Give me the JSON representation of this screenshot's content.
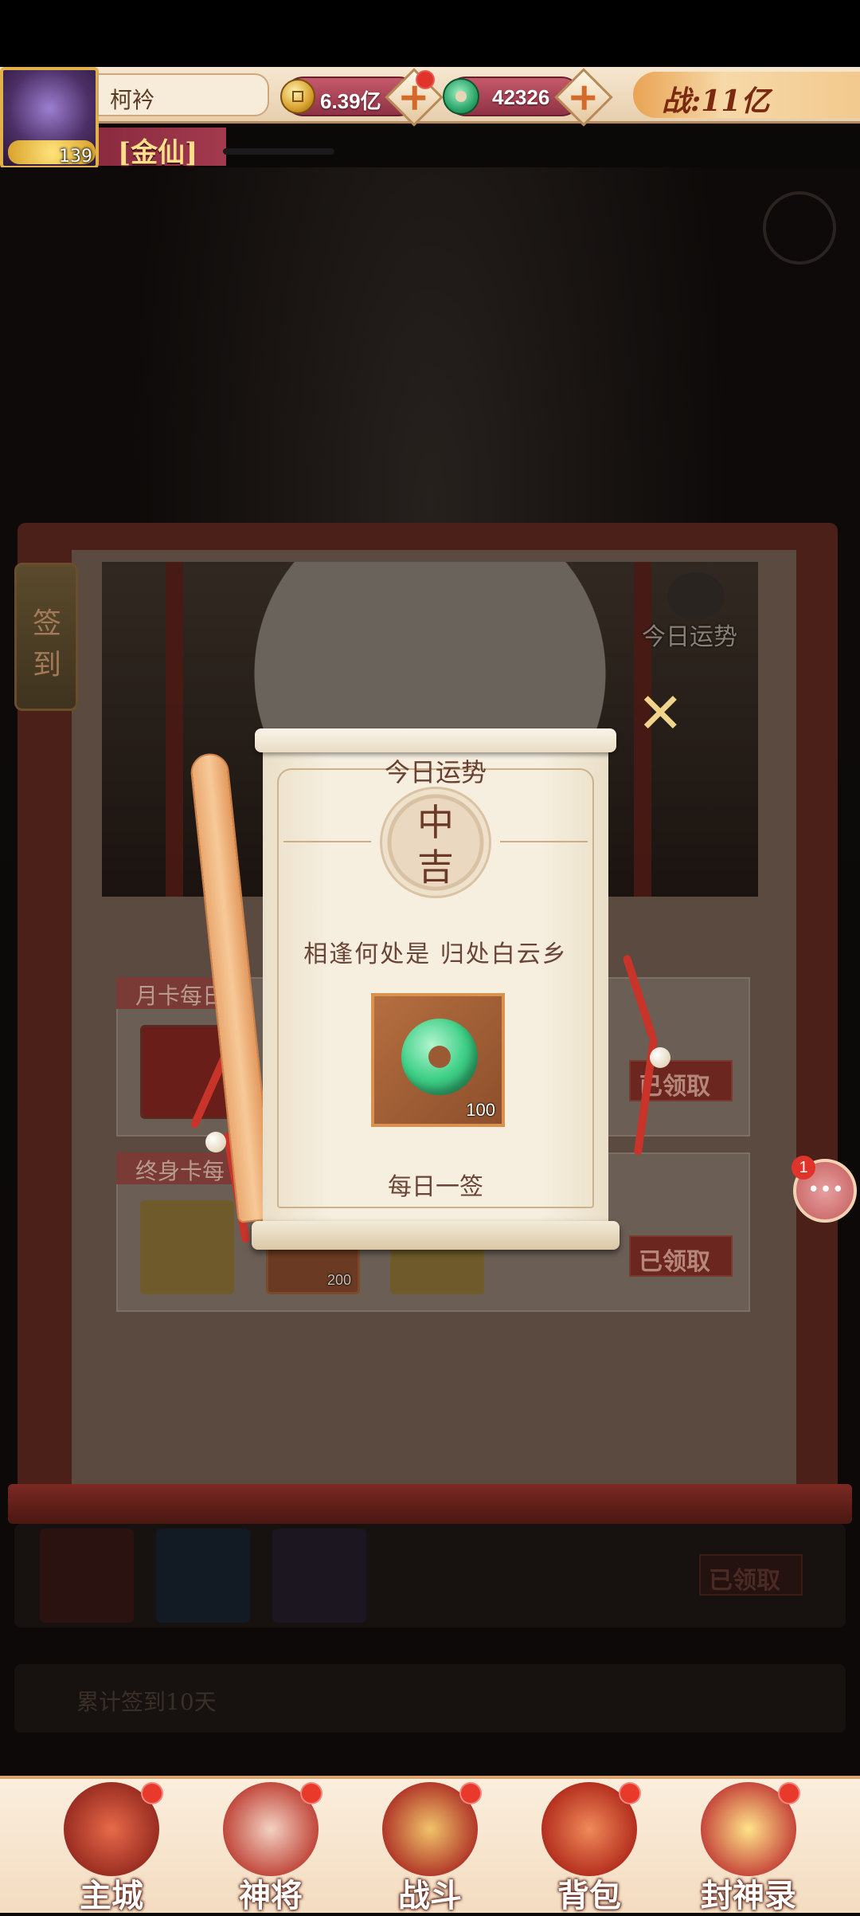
{
  "hud": {
    "player_name": "柯衿",
    "level": "139",
    "title": "[金仙]",
    "gold": "6.39亿",
    "jade": "42326",
    "power": "战:11亿"
  },
  "signin": {
    "tab_label_top": "签",
    "tab_label_bottom": "到",
    "today_fortune_label": "今日运势",
    "row1_tag": "月卡每日",
    "row2_tag": "终身卡每",
    "claimed": "已领取",
    "row2_item_count": "200",
    "bg_claimed": "已领取",
    "bg_streak": "累计签到10天"
  },
  "popup": {
    "title": "今日运势",
    "fortune_top": "中",
    "fortune_bottom": "吉",
    "poem": "相逢何处是  归处白云乡",
    "item_count": "100",
    "daily_label": "每日一签"
  },
  "chat": {
    "badge": "1"
  },
  "nav": {
    "items": [
      {
        "label": "主城",
        "icon": "castle-icon"
      },
      {
        "label": "神将",
        "icon": "hero-icon"
      },
      {
        "label": "战斗",
        "icon": "crossed-swords-icon"
      },
      {
        "label": "背包",
        "icon": "bag-icon"
      },
      {
        "label": "封神录",
        "icon": "dragon-book-icon"
      }
    ]
  },
  "colors": {
    "accent_red": "#e0342a",
    "title_gold": "#ffdf8a",
    "panel_red": "#4a2018",
    "parchment": "#f6efe0"
  }
}
